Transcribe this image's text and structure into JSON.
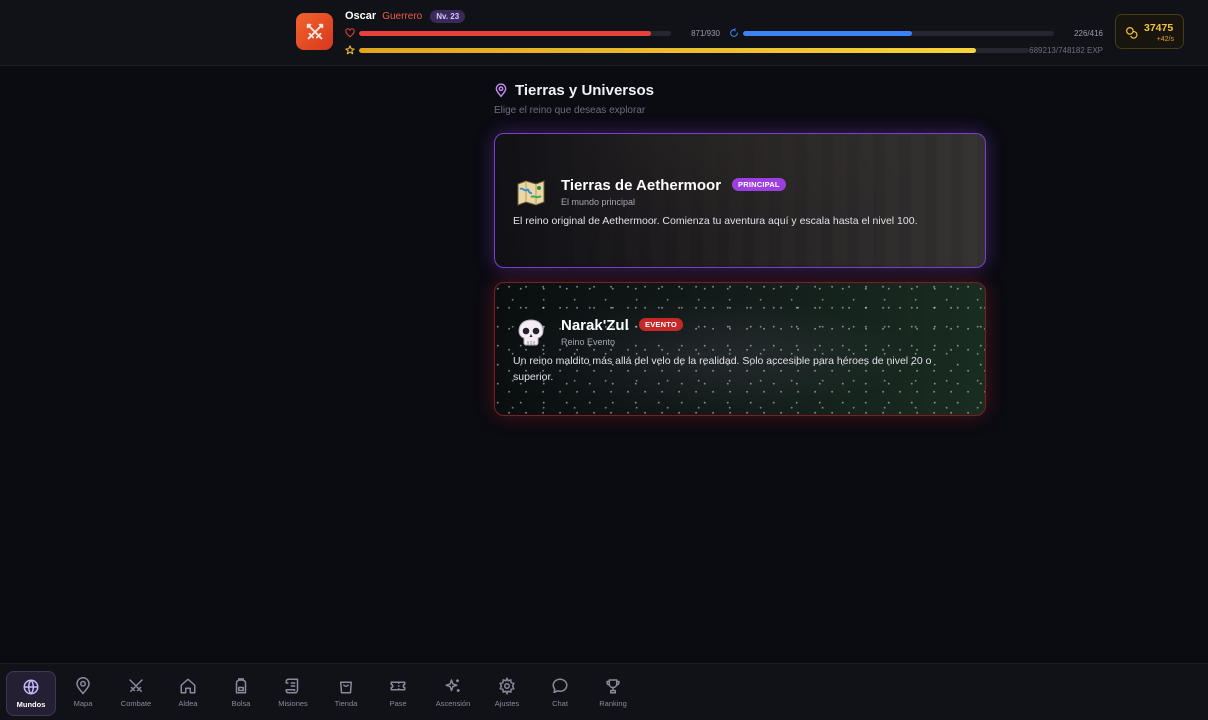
{
  "player": {
    "name": "Oscar",
    "class": "Guerrero",
    "level_label": "Nv. 23",
    "avatar_icon": "crossed-swords-icon",
    "hp": {
      "text": "871/930",
      "current": 871,
      "max": 930,
      "color": "#e8403a"
    },
    "mana": {
      "text": "226/416",
      "current": 226,
      "max": 416,
      "color": "#3b82f6"
    },
    "exp": {
      "text": "689213/748182 EXP",
      "current": 689213,
      "max": 748182,
      "color": "#f2c12e"
    }
  },
  "currency": {
    "amount": "37475",
    "rate": "+42/s",
    "icon": "coins-icon",
    "color": "#f3c63a"
  },
  "page": {
    "title": "Tierras y Universos",
    "subtitle": "Elige el reino que deseas explorar",
    "icon": "map-pin-icon"
  },
  "worlds": [
    {
      "name": "Tierras de Aethermoor",
      "badge": "PRINCIPAL",
      "badge_color": "#9b3fe0",
      "subtitle": "El mundo principal",
      "description": "El reino original de Aethermoor. Comienza tu aventura aquí y escala hasta el nivel 100.",
      "icon": "map-icon"
    },
    {
      "name": "Narak'Zul",
      "badge": "EVENTO",
      "badge_color": "#c62828",
      "subtitle": "Reino Evento",
      "description": "Un reino maldito más allá del velo de la realidad. Solo accesible para héroes de nivel 20 o superior.",
      "icon": "skull-icon"
    }
  ],
  "nav": {
    "active": "Mundos",
    "items": [
      {
        "label": "Mundos",
        "icon": "globe-icon"
      },
      {
        "label": "Mapa",
        "icon": "map-pin-icon"
      },
      {
        "label": "Combate",
        "icon": "crossed-swords-icon"
      },
      {
        "label": "Aldea",
        "icon": "home-icon"
      },
      {
        "label": "Bolsa",
        "icon": "backpack-icon"
      },
      {
        "label": "Misiones",
        "icon": "scroll-icon"
      },
      {
        "label": "Tienda",
        "icon": "shopping-bag-icon"
      },
      {
        "label": "Pase",
        "icon": "ticket-icon"
      },
      {
        "label": "Ascensión",
        "icon": "sparkles-icon"
      },
      {
        "label": "Ajustes",
        "icon": "gear-icon"
      },
      {
        "label": "Chat",
        "icon": "chat-bubble-icon"
      },
      {
        "label": "Ranking",
        "icon": "trophy-icon"
      }
    ]
  }
}
